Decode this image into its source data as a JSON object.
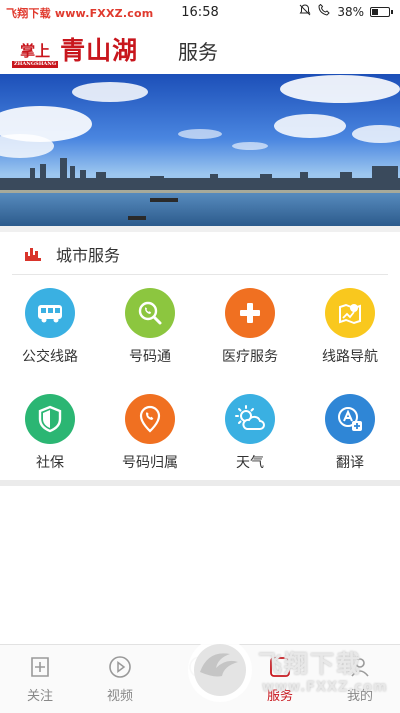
{
  "status_bar": {
    "watermark": "飞翔下载 www.FXXZ.com",
    "time": "16:58",
    "battery": "38%",
    "battery_level": 0.38
  },
  "header": {
    "logo_small": "掌上",
    "logo_small_sub": "ZHANGSHANG",
    "logo_big": "青山湖",
    "title": "服务"
  },
  "section": {
    "title": "城市服务"
  },
  "services": [
    {
      "label": "公交线路",
      "icon": "bus-icon",
      "color": "#3ab0e2"
    },
    {
      "label": "号码通",
      "icon": "phone-search-icon",
      "color": "#8cc63f"
    },
    {
      "label": "医疗服务",
      "icon": "medical-plus-icon",
      "color": "#f07021"
    },
    {
      "label": "线路导航",
      "icon": "map-navigation-icon",
      "color": "#f9c81e"
    },
    {
      "label": "社保",
      "icon": "shield-icon",
      "color": "#2bb673"
    },
    {
      "label": "号码归属",
      "icon": "phone-location-icon",
      "color": "#f07021"
    },
    {
      "label": "天气",
      "icon": "weather-icon",
      "color": "#3ab0e2"
    },
    {
      "label": "翻译",
      "icon": "translate-icon",
      "color": "#2f86d6"
    }
  ],
  "tabs": [
    {
      "label": "关注",
      "icon": "follow-icon"
    },
    {
      "label": "视频",
      "icon": "video-play-icon"
    },
    {
      "label": "",
      "icon": "home-icon"
    },
    {
      "label": "服务",
      "icon": "service-icon"
    },
    {
      "label": "我的",
      "icon": "profile-icon"
    }
  ],
  "overlay": {
    "brand_text": "飞翔下载",
    "brand_url": "www.FXXZ.com"
  }
}
